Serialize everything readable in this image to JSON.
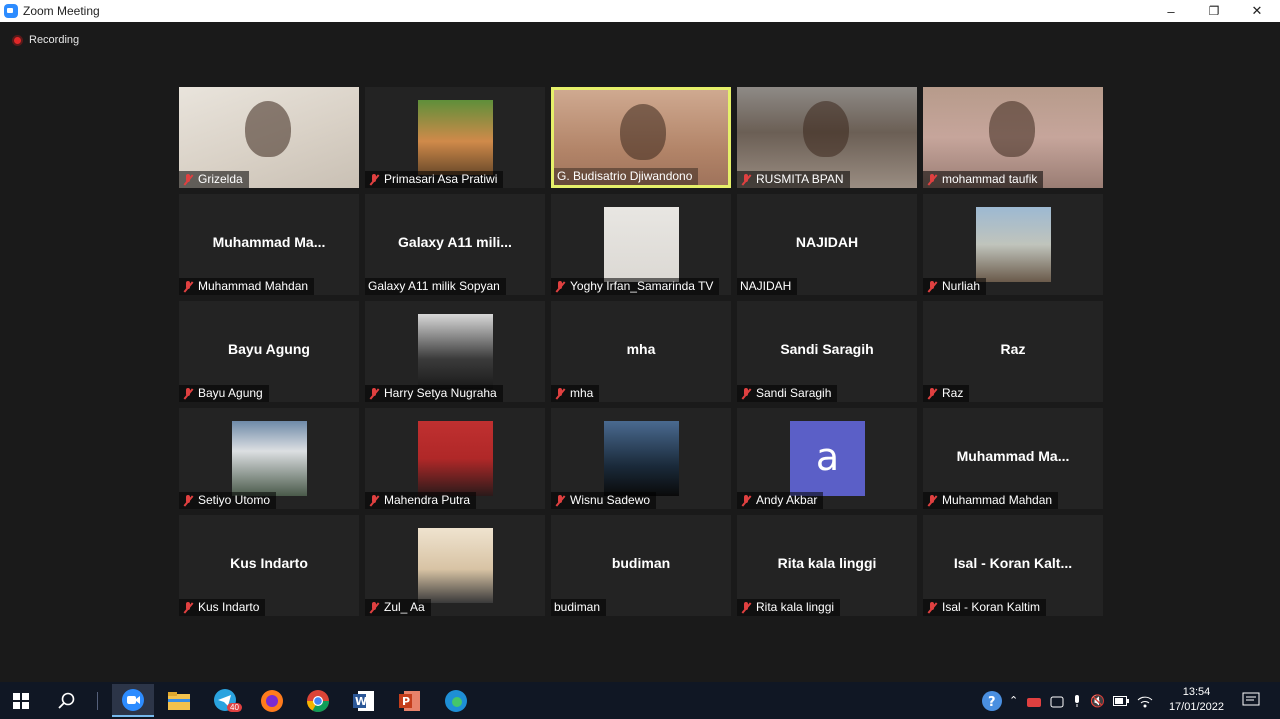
{
  "window": {
    "title": "Zoom Meeting",
    "minimize": "–",
    "restore": "❐",
    "close": "✕"
  },
  "recording": {
    "label": "Recording"
  },
  "participants": [
    {
      "label": "Grizelda",
      "display": "",
      "muted": true,
      "type": "video"
    },
    {
      "label": "Primasari Asa Pratiwi",
      "display": "",
      "muted": true,
      "type": "avatar"
    },
    {
      "label": "G. Budisatrio Djiwandono",
      "display": "",
      "muted": false,
      "type": "video",
      "active": true
    },
    {
      "label": "RUSMITA BPAN",
      "display": "",
      "muted": true,
      "type": "video"
    },
    {
      "label": "mohammad taufik",
      "display": "",
      "muted": true,
      "type": "video"
    },
    {
      "label": "Muhammad Mahdan",
      "display": "Muhammad  Ma...",
      "muted": true,
      "type": "name"
    },
    {
      "label": "Galaxy A11 milik Sopyan",
      "display": "Galaxy A11 mili...",
      "muted": false,
      "type": "name"
    },
    {
      "label": "Yoghy Irfan_Samarinda TV",
      "display": "",
      "muted": true,
      "type": "avatar"
    },
    {
      "label": "NAJIDAH",
      "display": "NAJIDAH",
      "muted": false,
      "type": "name"
    },
    {
      "label": "Nurliah",
      "display": "",
      "muted": true,
      "type": "avatar"
    },
    {
      "label": "Bayu Agung",
      "display": "Bayu Agung",
      "muted": true,
      "type": "name"
    },
    {
      "label": "Harry Setya Nugraha",
      "display": "",
      "muted": true,
      "type": "avatar"
    },
    {
      "label": "mha",
      "display": "mha",
      "muted": true,
      "type": "name"
    },
    {
      "label": "Sandi Saragih",
      "display": "Sandi Saragih",
      "muted": true,
      "type": "name"
    },
    {
      "label": "Raz",
      "display": "Raz",
      "muted": true,
      "type": "name"
    },
    {
      "label": "Setiyo Utomo",
      "display": "",
      "muted": true,
      "type": "avatar"
    },
    {
      "label": "Mahendra Putra",
      "display": "",
      "muted": true,
      "type": "avatar"
    },
    {
      "label": "Wisnu Sadewo",
      "display": "",
      "muted": true,
      "type": "avatar"
    },
    {
      "label": "Andy Akbar",
      "display": "a",
      "muted": true,
      "type": "letter"
    },
    {
      "label": "Muhammad Mahdan",
      "display": "Muhammad  Ma...",
      "muted": true,
      "type": "name"
    },
    {
      "label": "Kus Indarto",
      "display": "Kus Indarto",
      "muted": true,
      "type": "name"
    },
    {
      "label": "Zul_ Aa",
      "display": "",
      "muted": true,
      "type": "avatar"
    },
    {
      "label": "budiman",
      "display": "budiman",
      "muted": false,
      "type": "name"
    },
    {
      "label": "Rita kala linggi",
      "display": "Rita kala linggi",
      "muted": true,
      "type": "name"
    },
    {
      "label": "Isal - Koran Kaltim",
      "display": "Isal - Koran Kalt...",
      "muted": true,
      "type": "name"
    }
  ],
  "taskbar": {
    "apps": [
      "start-icon",
      "search-icon",
      "zoom-icon",
      "file-explorer-icon",
      "telegram-icon",
      "firefox-icon",
      "chrome-icon",
      "word-icon",
      "powerpoint-icon",
      "edge-icon"
    ],
    "telegram_badge": "40",
    "time": "13:54",
    "date": "17/01/2022"
  },
  "colors": {
    "active_speaker": "#e6f06a",
    "muted_icon": "#e04040",
    "letter_avatar": "#5b5fc7"
  }
}
